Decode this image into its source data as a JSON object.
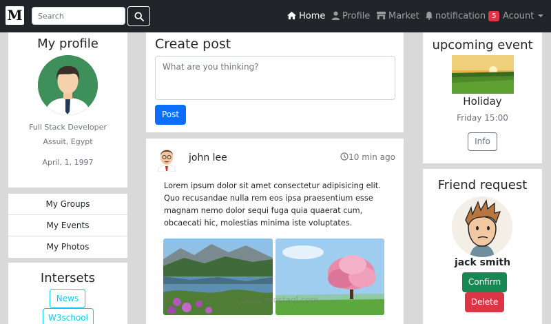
{
  "navbar": {
    "brand": "M",
    "search_placeholder": "Search",
    "links": {
      "home": "Home",
      "profile": "Profile",
      "market": "Market",
      "notification": "notification",
      "notification_count": "5",
      "account": "Acount"
    }
  },
  "profile": {
    "title": "My profile",
    "role": "Full Stack Developer",
    "location": "Assuit, Egypt",
    "date": "April, 1, 1997"
  },
  "menu": {
    "items": [
      "My Groups",
      "My Events",
      "My Photos"
    ]
  },
  "interests": {
    "title": "Intersets",
    "tags": [
      "News",
      "W3school"
    ]
  },
  "create_post": {
    "title": "Create post",
    "placeholder": "What are you thinking?",
    "button": "Post"
  },
  "post": {
    "author": "john lee",
    "time": "10 min ago",
    "text": "Lorem ipsum dolor sit amet consectetur adipisicing elit. Quo recusandae nulla rem eos ipsa praesentium esse magnam nemo dolor sequi fuga quia quaerat cum, obcaecati hic, molestias minima iste voluptates."
  },
  "event": {
    "title": "upcoming event",
    "name": "Holiday",
    "time": "Friday 15:00",
    "button": "Info"
  },
  "friend_request": {
    "title": "Friend request",
    "name": "jack smith",
    "confirm": "Confirm",
    "delete": "Delete"
  },
  "watermark": "مستقل mostaql.com",
  "colors": {
    "navbar": "#212529",
    "primary": "#0d6efd",
    "success": "#198754",
    "danger": "#dc3545",
    "info": "#0dcaf0"
  }
}
